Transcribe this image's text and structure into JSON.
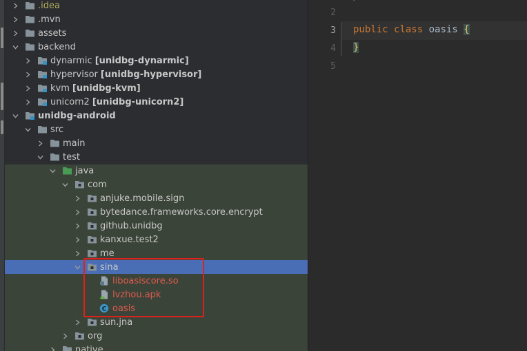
{
  "tree": {
    "items": [
      {
        "label": "",
        "name": ".idea",
        "module": "",
        "depth": 1,
        "expanded": false,
        "icon": "folder-icon",
        "style": "idea"
      },
      {
        "label": ".mvn",
        "module": "",
        "depth": 1,
        "expanded": false,
        "icon": "folder-icon",
        "style": ""
      },
      {
        "label": "assets",
        "module": "",
        "depth": 1,
        "expanded": false,
        "icon": "folder-icon",
        "style": ""
      },
      {
        "label": "backend",
        "module": "",
        "depth": 1,
        "expanded": true,
        "icon": "folder-icon",
        "style": ""
      },
      {
        "label": "dynarmic",
        "module": "[unidbg-dynarmic]",
        "depth": 2,
        "expanded": false,
        "icon": "module-folder-icon",
        "style": ""
      },
      {
        "label": "hypervisor",
        "module": "[unidbg-hypervisor]",
        "depth": 2,
        "expanded": false,
        "icon": "module-folder-icon",
        "style": ""
      },
      {
        "label": "kvm",
        "module": "[unidbg-kvm]",
        "depth": 2,
        "expanded": false,
        "icon": "module-folder-icon",
        "style": ""
      },
      {
        "label": "unicorn2",
        "module": "[unidbg-unicorn2]",
        "depth": 2,
        "expanded": false,
        "icon": "module-folder-icon",
        "style": ""
      },
      {
        "label": "unidbg-android",
        "module": "",
        "depth": 1,
        "expanded": true,
        "icon": "module-folder-icon",
        "style": "bold"
      },
      {
        "label": "src",
        "module": "",
        "depth": 2,
        "expanded": true,
        "icon": "folder-icon",
        "style": ""
      },
      {
        "label": "main",
        "module": "",
        "depth": 3,
        "expanded": false,
        "icon": "folder-icon",
        "style": ""
      },
      {
        "label": "test",
        "module": "",
        "depth": 3,
        "expanded": true,
        "icon": "folder-icon",
        "style": ""
      },
      {
        "label": "java",
        "module": "",
        "depth": 4,
        "expanded": true,
        "icon": "test-source-folder-icon",
        "style": ""
      },
      {
        "label": "com",
        "module": "",
        "depth": 5,
        "expanded": true,
        "icon": "package-icon",
        "style": ""
      },
      {
        "label": "anjuke.mobile.sign",
        "module": "",
        "depth": 6,
        "expanded": false,
        "icon": "package-icon",
        "style": ""
      },
      {
        "label": "bytedance.frameworks.core.encrypt",
        "module": "",
        "depth": 6,
        "expanded": false,
        "icon": "package-icon",
        "style": ""
      },
      {
        "label": "github.unidbg",
        "module": "",
        "depth": 6,
        "expanded": false,
        "icon": "package-icon",
        "style": ""
      },
      {
        "label": "kanxue.test2",
        "module": "",
        "depth": 6,
        "expanded": false,
        "icon": "package-icon",
        "style": ""
      },
      {
        "label": "me",
        "module": "",
        "depth": 6,
        "expanded": false,
        "icon": "package-icon",
        "style": ""
      },
      {
        "label": "sina",
        "module": "",
        "depth": 6,
        "expanded": true,
        "icon": "package-icon",
        "style": "",
        "selected": true
      },
      {
        "label": "liboasiscore.so",
        "module": "",
        "depth": 7,
        "expanded": null,
        "icon": "so-file-icon",
        "style": "err"
      },
      {
        "label": "lvzhou.apk",
        "module": "",
        "depth": 7,
        "expanded": null,
        "icon": "apk-file-icon",
        "style": "err"
      },
      {
        "label": "oasis",
        "module": "",
        "depth": 7,
        "expanded": null,
        "icon": "java-class-icon",
        "style": "err"
      },
      {
        "label": "sun.jna",
        "module": "",
        "depth": 6,
        "expanded": false,
        "icon": "package-icon",
        "style": ""
      },
      {
        "label": "org",
        "module": "",
        "depth": 5,
        "expanded": false,
        "icon": "package-icon",
        "style": ""
      },
      {
        "label": "native",
        "module": "",
        "depth": 4,
        "expanded": false,
        "icon": "folder-icon",
        "style": ""
      }
    ]
  },
  "editor": {
    "line_numbers": [
      "2",
      "3",
      "4",
      "5"
    ],
    "current_line": "3",
    "line3": {
      "kw1": "public",
      "kw2": "class",
      "name": "oasis",
      "brace": "{"
    },
    "line4": {
      "brace": "}"
    }
  },
  "colors": {
    "selection": "#4a6eb5",
    "test_highlight": "#3b4438",
    "annotation": "#e0211b",
    "error_text": "#e05a4f",
    "keyword": "#cc7832"
  }
}
